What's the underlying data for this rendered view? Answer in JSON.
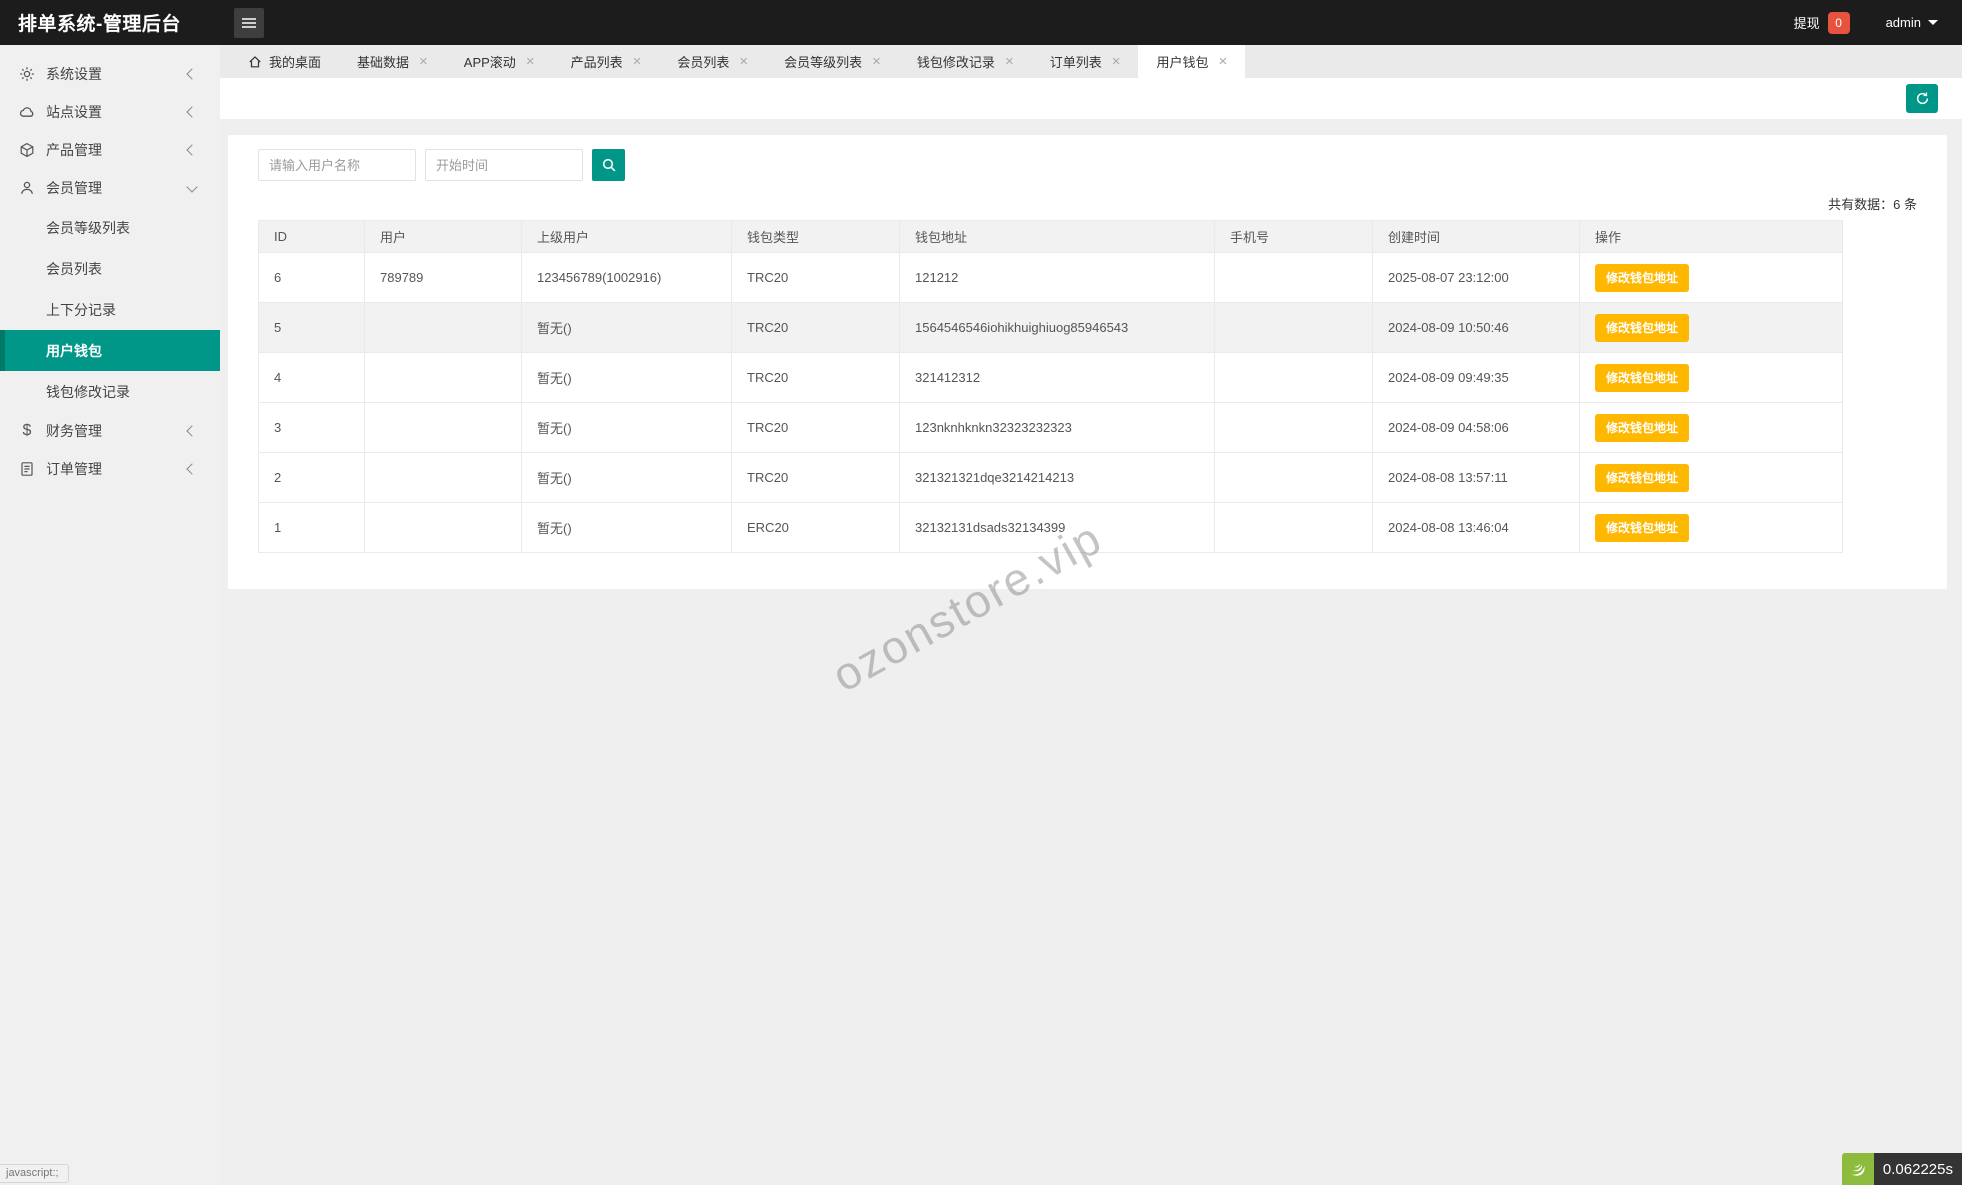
{
  "topbar": {
    "title": "排单系统-管理后台",
    "withdraw_label": "提现",
    "withdraw_count": "0",
    "user": "admin"
  },
  "tabs": [
    {
      "label": "我的桌面",
      "home": true,
      "closable": false,
      "active": false
    },
    {
      "label": "基础数据",
      "closable": true,
      "active": false
    },
    {
      "label": "APP滚动",
      "closable": true,
      "active": false
    },
    {
      "label": "产品列表",
      "closable": true,
      "active": false
    },
    {
      "label": "会员列表",
      "closable": true,
      "active": false
    },
    {
      "label": "会员等级列表",
      "closable": true,
      "active": false
    },
    {
      "label": "钱包修改记录",
      "closable": true,
      "active": false
    },
    {
      "label": "订单列表",
      "closable": true,
      "active": false
    },
    {
      "label": "用户钱包",
      "closable": true,
      "active": true
    }
  ],
  "sidebar": {
    "items": [
      {
        "label": "系统设置",
        "icon": "gear-icon",
        "expanded": false
      },
      {
        "label": "站点设置",
        "icon": "cloud-icon",
        "expanded": false
      },
      {
        "label": "产品管理",
        "icon": "box-icon",
        "expanded": false
      },
      {
        "label": "会员管理",
        "icon": "user-icon",
        "expanded": true,
        "children": [
          {
            "label": "会员等级列表",
            "active": false
          },
          {
            "label": "会员列表",
            "active": false
          },
          {
            "label": "上下分记录",
            "active": false
          },
          {
            "label": "用户钱包",
            "active": true
          },
          {
            "label": "钱包修改记录",
            "active": false
          }
        ]
      },
      {
        "label": "财务管理",
        "icon": "dollar-icon",
        "expanded": false
      },
      {
        "label": "订单管理",
        "icon": "order-icon",
        "expanded": false
      }
    ]
  },
  "filters": {
    "username_placeholder": "请输入用户名称",
    "start_time_placeholder": "开始时间"
  },
  "summary": {
    "total_text": "共有数据：6 条"
  },
  "table": {
    "headers": [
      "ID",
      "用户",
      "上级用户",
      "钱包类型",
      "钱包地址",
      "手机号",
      "创建时间",
      "操作"
    ],
    "action_label": "修改钱包地址",
    "rows": [
      {
        "id": "6",
        "user": "789789",
        "parent": "123456789(1002916)",
        "wallet_type": "TRC20",
        "wallet_address": "121212",
        "phone": "",
        "created": "2025-08-07 23:12:00"
      },
      {
        "id": "5",
        "user": "",
        "parent": "暂无()",
        "wallet_type": "TRC20",
        "wallet_address": "1564546546iohikhuighiuog85946543",
        "phone": "",
        "created": "2024-08-09 10:50:46"
      },
      {
        "id": "4",
        "user": "",
        "parent": "暂无()",
        "wallet_type": "TRC20",
        "wallet_address": "321412312",
        "phone": "",
        "created": "2024-08-09 09:49:35"
      },
      {
        "id": "3",
        "user": "",
        "parent": "暂无()",
        "wallet_type": "TRC20",
        "wallet_address": "123nknhknkn32323232323",
        "phone": "",
        "created": "2024-08-09 04:58:06"
      },
      {
        "id": "2",
        "user": "",
        "parent": "暂无()",
        "wallet_type": "TRC20",
        "wallet_address": "321321321dqe3214214213",
        "phone": "",
        "created": "2024-08-08 13:57:11"
      },
      {
        "id": "1",
        "user": "",
        "parent": "暂无()",
        "wallet_type": "ERC20",
        "wallet_address": "32132131dsads32134399",
        "phone": "",
        "created": "2024-08-08 13:46:04"
      }
    ]
  },
  "watermark": "ozonstore.vip",
  "statusbar": {
    "left_text": "javascript:;",
    "timer": "0.062225s"
  },
  "colors": {
    "accent_teal": "#009688",
    "action_yellow": "#ffb800",
    "badge_red": "#e8533f",
    "active_subitem_border": "#00796b"
  }
}
